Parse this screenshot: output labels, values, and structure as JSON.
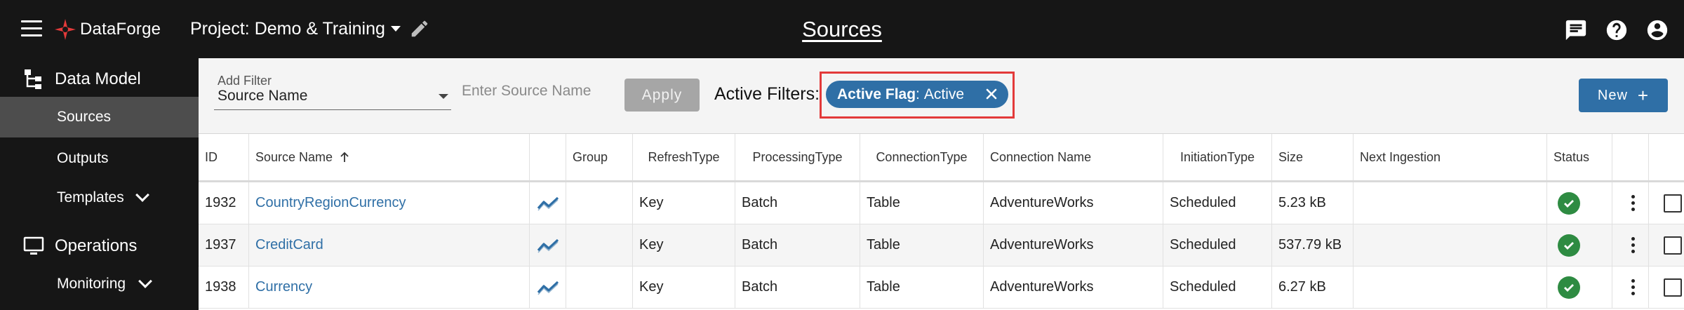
{
  "header": {
    "brand": "DataForge",
    "project": "Project: Demo & Training",
    "page_title": "Sources",
    "icons": [
      "menu-icon",
      "chat-icon",
      "help-icon",
      "account-icon"
    ]
  },
  "sidebar": {
    "data_model": "Data Model",
    "sources": "Sources",
    "outputs": "Outputs",
    "templates": "Templates",
    "operations": "Operations",
    "monitoring": "Monitoring"
  },
  "filters": {
    "add_filter_label": "Add Filter",
    "add_filter_value": "Source Name",
    "source_placeholder": "Enter Source Name",
    "apply": "Apply",
    "active_filters_label": "Active Filters:",
    "chip_key": "Active Flag",
    "chip_sep": ":",
    "chip_value": "Active",
    "new_label": "New",
    "new_plus": "+"
  },
  "table": {
    "headers": {
      "id": "ID",
      "name": "Source Name",
      "group": "Group",
      "refresh_1": "Refresh",
      "refresh_2": "Type",
      "processing_1": "Processing",
      "processing_2": "Type",
      "connection_1": "Connection",
      "connection_2": "Type",
      "connection_name": "Connection Name",
      "initiation_1": "Initiation",
      "initiation_2": "Type",
      "size": "Size",
      "next": "Next Ingestion",
      "status": "Status"
    },
    "rows": [
      {
        "id": "1932",
        "name": "CountryRegionCurrency",
        "group": "",
        "refresh": "Key",
        "processing": "Batch",
        "connection_type": "Table",
        "connection_name": "AdventureWorks",
        "initiation": "Scheduled",
        "size": "5.23 kB",
        "next": ""
      },
      {
        "id": "1937",
        "name": "CreditCard",
        "group": "",
        "refresh": "Key",
        "processing": "Batch",
        "connection_type": "Table",
        "connection_name": "AdventureWorks",
        "initiation": "Scheduled",
        "size": "537.79 kB",
        "next": ""
      },
      {
        "id": "1938",
        "name": "Currency",
        "group": "",
        "refresh": "Key",
        "processing": "Batch",
        "connection_type": "Table",
        "connection_name": "AdventureWorks",
        "initiation": "Scheduled",
        "size": "6.27 kB",
        "next": ""
      }
    ]
  },
  "colors": {
    "topbar": "#161616",
    "accent": "#2f6fa6",
    "status_ok": "#2e8b42",
    "highlight": "#e33a3a"
  }
}
